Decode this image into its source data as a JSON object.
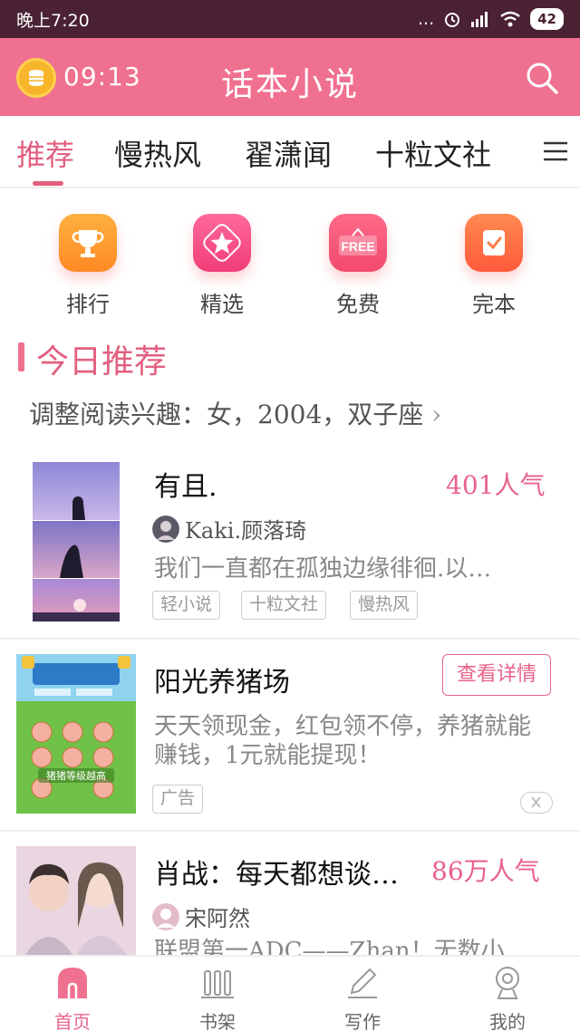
{
  "status_bar": {
    "time": "晚上7:20",
    "signal_text": "...",
    "battery": "42"
  },
  "app_bar": {
    "timer": "09:13",
    "title": "话本小说"
  },
  "tabs": [
    {
      "label": "推荐"
    },
    {
      "label": "慢热风"
    },
    {
      "label": "翟潇闻"
    },
    {
      "label": "十粒文社"
    }
  ],
  "quick_links": [
    {
      "label": "排行",
      "icon": "trophy-icon"
    },
    {
      "label": "精选",
      "icon": "star-icon"
    },
    {
      "label": "免费",
      "icon": "free-icon",
      "badge": "FREE"
    },
    {
      "label": "完本",
      "icon": "checkbook-icon"
    }
  ],
  "section": {
    "title": "今日推荐",
    "interest": "调整阅读兴趣：女，2004，双子座",
    "interest_arrow": "›"
  },
  "cards": [
    {
      "title": "有且.",
      "popularity": "401人气",
      "author": "Kaki.顾落琦",
      "desc": "我们一直都在孤独边缘徘徊.以…",
      "tags": [
        "轻小说",
        "十粒文社",
        "慢热风"
      ]
    },
    {
      "title": "阳光养猪场",
      "button": "查看详情",
      "desc": "天天领现金，红包领不停，养猪就能赚钱，1元就能提现！",
      "tag": "广告",
      "image_caption": "猪猪等级越高"
    },
    {
      "title": "肖战：每天都想谈…",
      "popularity": "86万人气",
      "author": "宋阿然",
      "desc": "联盟第一ADC——Zhan！无数小…"
    }
  ],
  "bottom_nav": [
    {
      "label": "首页",
      "icon": "home-icon"
    },
    {
      "label": "书架",
      "icon": "bookshelf-icon"
    },
    {
      "label": "写作",
      "icon": "pen-icon"
    },
    {
      "label": "我的",
      "icon": "profile-icon"
    }
  ],
  "colors": {
    "accent": "#f07090",
    "accent_text": "#e8638a",
    "status_bar": "#4a2233"
  }
}
